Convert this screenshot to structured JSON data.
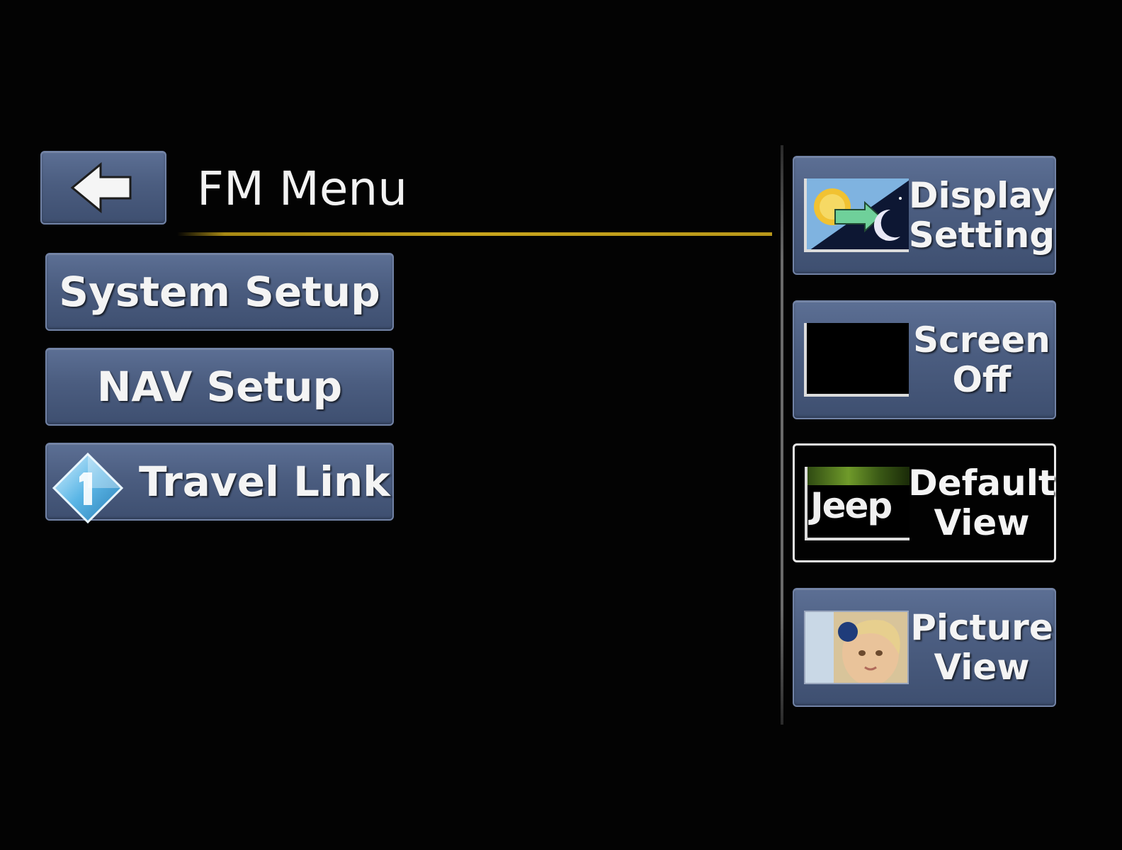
{
  "header": {
    "title": "FM Menu",
    "back_icon": "back-arrow-icon",
    "rule_color": "#c9a51c"
  },
  "menu": {
    "items": [
      {
        "label": "System Setup"
      },
      {
        "label": "NAV Setup"
      },
      {
        "label": "Travel Link",
        "icon": "travel-link-diamond-icon"
      }
    ]
  },
  "side": {
    "items": [
      {
        "line1": "Display",
        "line2": "Setting",
        "icon": "display-setting-icon"
      },
      {
        "line1": "Screen",
        "line2": "Off",
        "icon": "screen-off-icon"
      },
      {
        "line1": "Default",
        "line2": "View",
        "icon": "jeep-logo-icon",
        "logo_text": "Jeep",
        "selected": true
      },
      {
        "line1": "Picture",
        "line2": "View",
        "icon": "picture-thumbnail-icon"
      }
    ]
  },
  "colors": {
    "background": "#030303",
    "button_fill": "#4b5d80",
    "button_border": "#7283a6",
    "selected_border": "#e8e8e8",
    "text": "#f4f4f4"
  }
}
